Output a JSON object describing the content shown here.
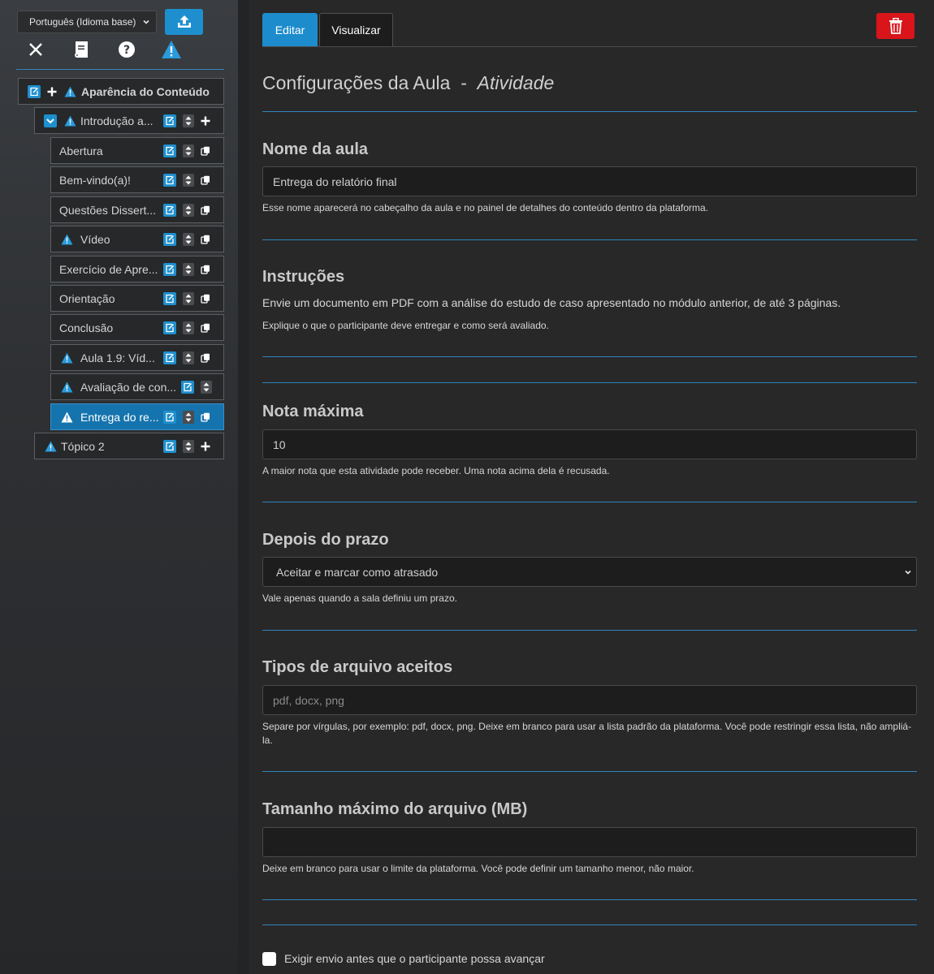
{
  "sidebar": {
    "language": "Português (Idioma base)",
    "tree": [
      {
        "label": "Aparência do Conteúdo",
        "level": 0,
        "warning": true
      },
      {
        "label": "Introdução a...",
        "level": 1,
        "warning": true
      },
      {
        "label": "Abertura",
        "level": 2,
        "warning": false
      },
      {
        "label": "Bem-vindo(a)!",
        "level": 2,
        "warning": false
      },
      {
        "label": "Questões Dissert...",
        "level": 2,
        "warning": false
      },
      {
        "label": "Vídeo",
        "level": 2,
        "warning": true
      },
      {
        "label": "Exercício de Apre...",
        "level": 2,
        "warning": false
      },
      {
        "label": "Orientação",
        "level": 2,
        "warning": false
      },
      {
        "label": "Conclusão",
        "level": 2,
        "warning": false
      },
      {
        "label": "Aula 1.9: Víd...",
        "level": 2,
        "warning": true
      },
      {
        "label": "Avaliação de con...",
        "level": 2,
        "warning": true
      },
      {
        "label": "Entrega do re...",
        "level": 2,
        "warning": true,
        "selected": true
      },
      {
        "label": "Tópico 2",
        "level": 1,
        "warning": true
      }
    ]
  },
  "main": {
    "tabs": {
      "edit": "Editar",
      "view": "Visualizar"
    },
    "title": {
      "main": "Configurações da Aula",
      "sep": "-",
      "type": "Atividade"
    },
    "lesson_name": {
      "label": "Nome da aula",
      "value": "Entrega do relatório final",
      "help": "Esse nome aparecerá no cabeçalho da aula e no painel de detalhes do conteúdo dentro da plataforma."
    },
    "instructions": {
      "label": "Instruções",
      "text": "Envie um documento em PDF com a análise do estudo de caso apresentado no módulo anterior, de até 3 páginas.",
      "help": "Explique o que o participante deve entregar e como será avaliado."
    },
    "max_grade": {
      "label": "Nota máxima",
      "value": "10",
      "help": "A maior nota que esta atividade pode receber. Uma nota acima dela é recusada."
    },
    "after_deadline": {
      "label": "Depois do prazo",
      "selected": "Aceitar e marcar como atrasado",
      "help": "Vale apenas quando a sala definiu um prazo."
    },
    "file_types": {
      "label": "Tipos de arquivo aceitos",
      "placeholder": "pdf, docx, png",
      "help": "Separe por vírgulas, por exemplo: pdf, docx, png. Deixe em branco para usar a lista padrão da plataforma. Você pode restringir essa lista, não ampliá-la."
    },
    "max_size": {
      "label": "Tamanho máximo do arquivo (MB)",
      "value": "",
      "help": "Deixe em branco para usar o limite da plataforma. Você pode definir um tamanho menor, não maior."
    },
    "require_submit": {
      "label": "Exigir envio antes que o participante possa avançar",
      "checked": false
    }
  },
  "colors": {
    "accent": "#1e8fce",
    "danger": "#d9141b",
    "divider": "#2f85bb",
    "warning": "#2a9bdc"
  }
}
